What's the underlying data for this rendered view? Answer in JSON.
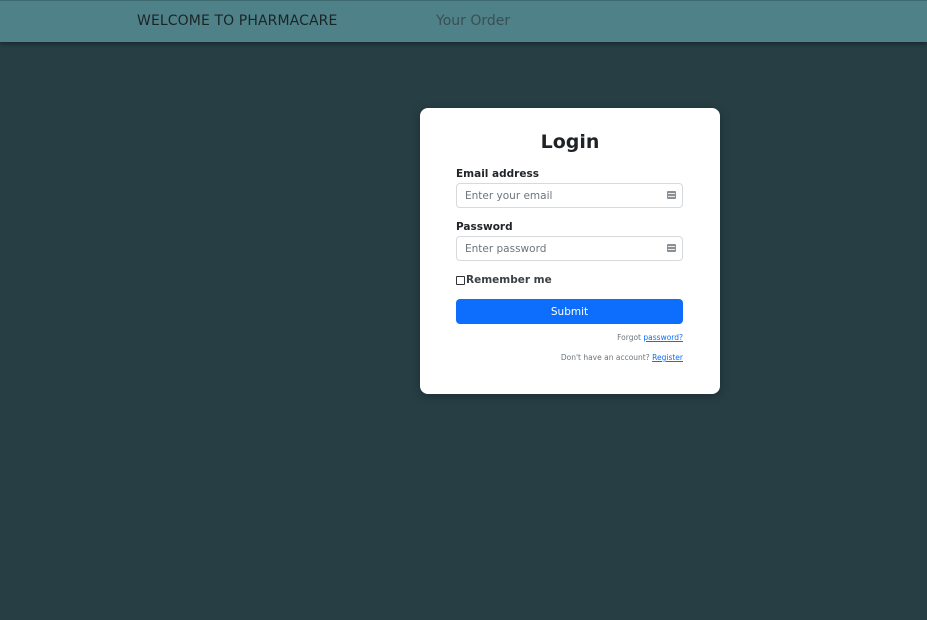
{
  "navbar": {
    "brand": "WELCOME TO PHARMACARE",
    "links": [
      "Your Order"
    ]
  },
  "login": {
    "title": "Login",
    "email": {
      "label": "Email address",
      "placeholder": "Enter your email",
      "value": ""
    },
    "password": {
      "label": "Password",
      "placeholder": "Enter password",
      "value": ""
    },
    "remember_label": "Remember me",
    "remember_checked": false,
    "submit_label": "Submit",
    "forgot_prefix": "Forgot",
    "forgot_link": "password?",
    "register_prefix": "Don't have an account?",
    "register_link": "Register"
  },
  "colors": {
    "background": "#263e44",
    "navbar": "#4f8189",
    "primary": "#0d6efd"
  },
  "icons": {
    "input_icon": "id-card-icon"
  }
}
